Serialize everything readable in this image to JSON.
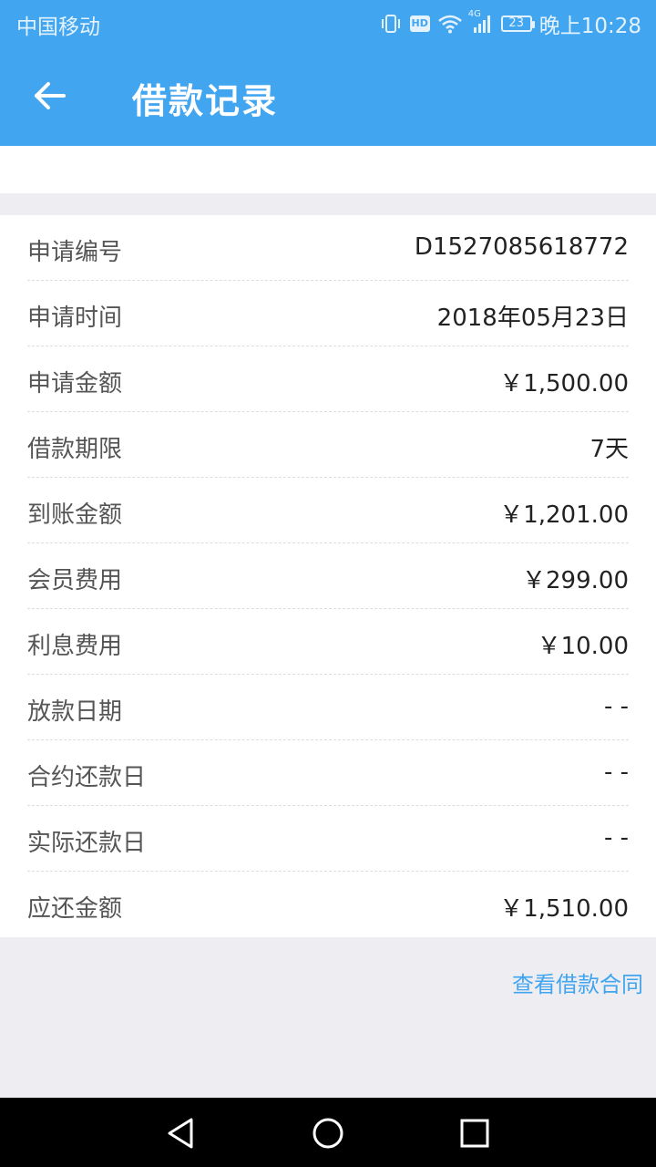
{
  "status_bar": {
    "carrier": "中国移动",
    "hd_label": "HD",
    "network_label": "4G",
    "battery": "23",
    "time": "晚上10:28"
  },
  "header": {
    "title": "借款记录",
    "back_icon": "arrow-left-icon"
  },
  "details": [
    {
      "label": "申请编号",
      "value": "D1527085618772"
    },
    {
      "label": "申请时间",
      "value": "2018年05月23日"
    },
    {
      "label": "申请金额",
      "value": "￥1,500.00"
    },
    {
      "label": "借款期限",
      "value": "7天"
    },
    {
      "label": "到账金额",
      "value": "￥1,201.00"
    },
    {
      "label": "会员费用",
      "value": "￥299.00"
    },
    {
      "label": "利息费用",
      "value": "￥10.00"
    },
    {
      "label": "放款日期",
      "value": "- -"
    },
    {
      "label": "合约还款日",
      "value": "- -"
    },
    {
      "label": "实际还款日",
      "value": "- -"
    },
    {
      "label": "应还金额",
      "value": "￥1,510.00"
    }
  ],
  "contract_link": "查看借款合同",
  "colors": {
    "header_bg": "#42a5f0",
    "link": "#42a5f0",
    "page_bg": "#eeeef2"
  },
  "system_nav": {
    "back_icon": "triangle-back-icon",
    "home_icon": "circle-home-icon",
    "recents_icon": "square-recents-icon"
  }
}
